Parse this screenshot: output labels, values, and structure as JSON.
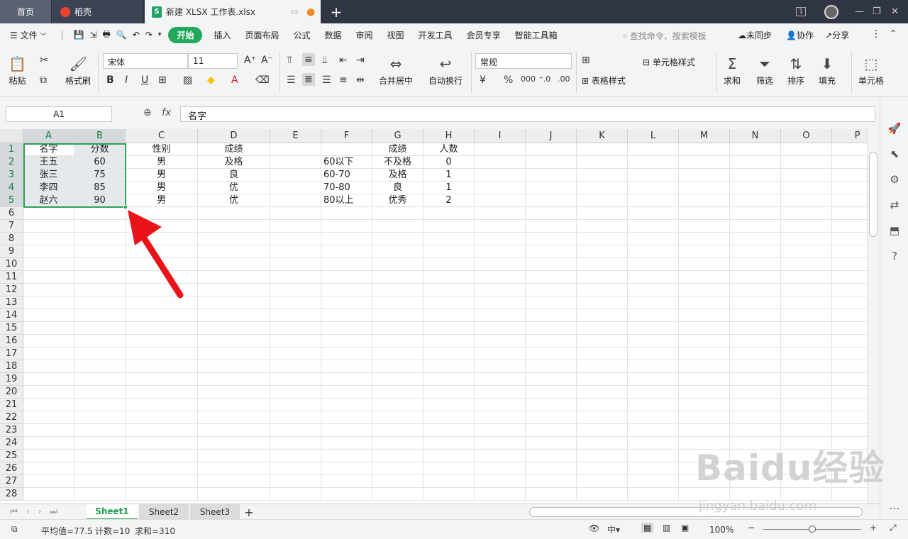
{
  "tabs": {
    "home": "首页",
    "daoke": "稻壳",
    "file": "新建 XLSX 工作表.xlsx",
    "add": "+"
  },
  "window": {
    "badge": "1",
    "minimize": "—",
    "restore": "❐",
    "close": "✕"
  },
  "menu": {
    "file": "文件",
    "items": [
      "开始",
      "插入",
      "页面布局",
      "公式",
      "数据",
      "审阅",
      "视图",
      "开发工具",
      "会员专享",
      "智能工具箱"
    ],
    "search_placeholder": "查找命令、搜索模板",
    "sync": "未同步",
    "collab": "协作",
    "share": "分享"
  },
  "ribbon": {
    "paste": "粘贴",
    "format_painter": "格式刷",
    "font": "宋体",
    "size": "11",
    "merge": "合并居中",
    "wrap": "自动换行",
    "number_format": "常规",
    "cell_style": "单元格样式",
    "table_style": "表格样式",
    "sum": "求和",
    "filter": "筛选",
    "sort": "排序",
    "fill": "填充",
    "cell": "单元格"
  },
  "formula_bar": {
    "name_box": "A1",
    "fx": "fx",
    "value": "名字"
  },
  "columns": [
    "A",
    "B",
    "C",
    "D",
    "E",
    "F",
    "G",
    "H",
    "I",
    "J",
    "K",
    "L",
    "M",
    "N",
    "O",
    "P"
  ],
  "rows": [
    "1",
    "2",
    "3",
    "4",
    "5",
    "6",
    "7",
    "8",
    "9",
    "10",
    "11",
    "12",
    "13",
    "14",
    "15",
    "16",
    "17",
    "18",
    "19",
    "20",
    "21",
    "22",
    "23",
    "24",
    "25",
    "26",
    "27",
    "28"
  ],
  "cells": {
    "A1": "名字",
    "B1": "分数",
    "C1": "性别",
    "D1": "成绩",
    "G1": "成绩",
    "H1": "人数",
    "A2": "王五",
    "B2": "60",
    "C2": "男",
    "D2": "及格",
    "F2": "60以下",
    "G2": "不及格",
    "H2": "0",
    "A3": "张三",
    "B3": "75",
    "C3": "男",
    "D3": "良",
    "F3": "60-70",
    "G3": "及格",
    "H3": "1",
    "A4": "李四",
    "B4": "85",
    "C4": "男",
    "D4": "优",
    "F4": "70-80",
    "G4": "良",
    "H4": "1",
    "A5": "赵六",
    "B5": "90",
    "C5": "男",
    "D5": "优",
    "F5": "80以上",
    "G5": "优秀",
    "H5": "2"
  },
  "sheets": [
    "Sheet1",
    "Sheet2",
    "Sheet3"
  ],
  "status": {
    "avg": "平均值=77.5",
    "count": "计数=10",
    "sum": "求和=310",
    "zoom": "100%"
  },
  "watermark": {
    "brand": "Baidu经验",
    "url": "jingyan.baidu.com"
  },
  "colors": {
    "accent": "#22a85c",
    "arrow": "#e8141a"
  }
}
